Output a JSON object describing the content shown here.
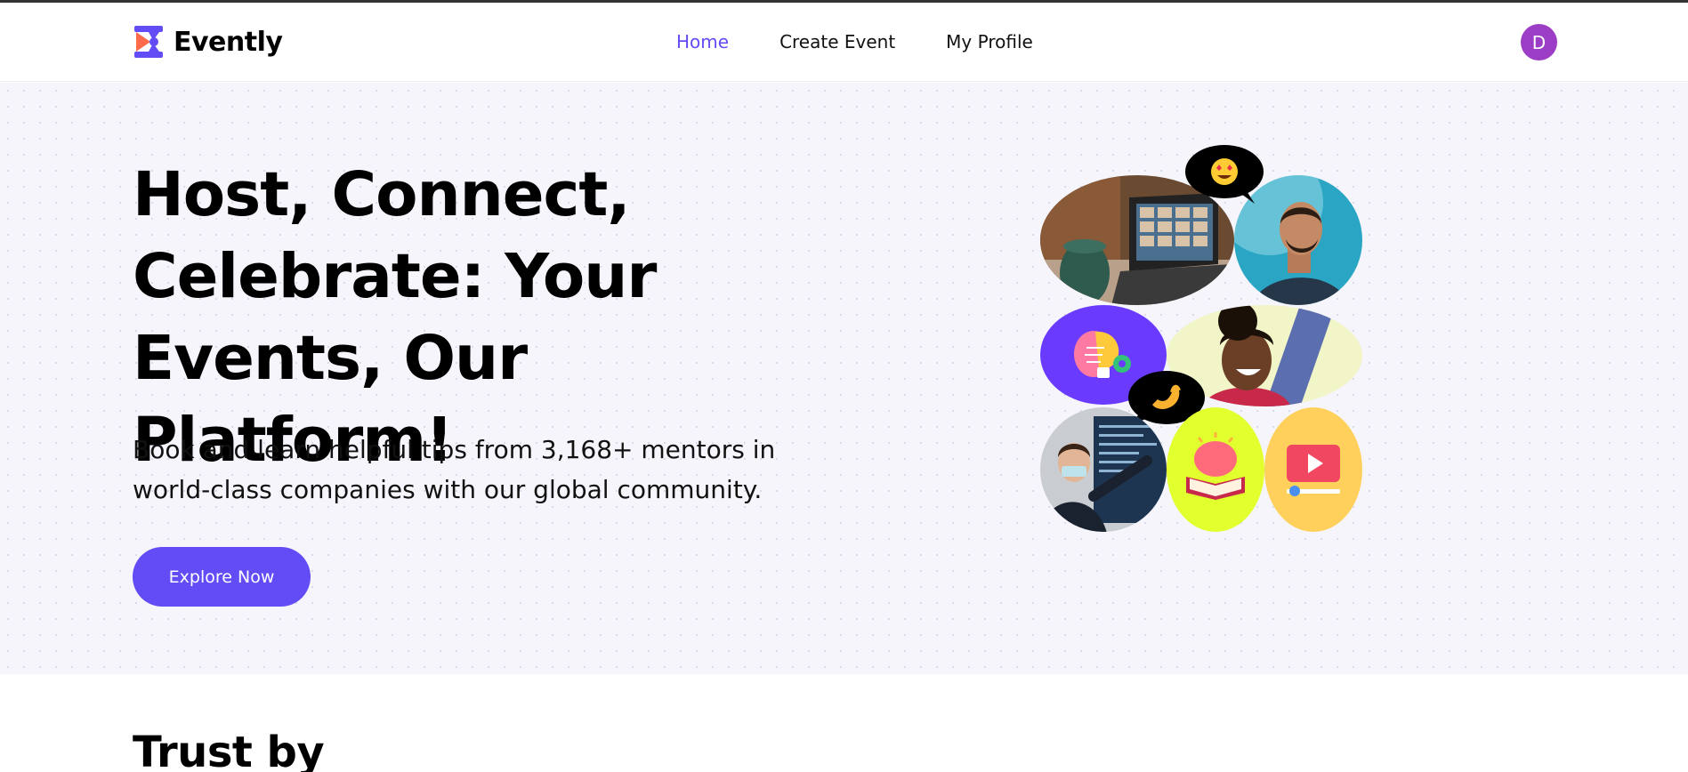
{
  "brand": {
    "name": "Evently"
  },
  "nav": {
    "items": [
      {
        "label": "Home",
        "active": true
      },
      {
        "label": "Create Event",
        "active": false
      },
      {
        "label": "My Profile",
        "active": false
      }
    ]
  },
  "user": {
    "avatar_initial": "D",
    "avatar_color": "#9c3dc6"
  },
  "hero": {
    "title_lines": [
      "Host, Connect,",
      "Celebrate: Your",
      "Events, Our Platform!"
    ],
    "subtitle_lines": [
      "Book and learn helpful tips from 3,168+ mentors in",
      "world-class companies with our global community."
    ],
    "cta_label": "Explore Now"
  },
  "trust": {
    "title": "Trust by"
  },
  "colors": {
    "accent": "#624cf5",
    "hero_bg": "#f5f5fb",
    "logo_orange": "#ff6b4a",
    "logo_purple": "#624cf5"
  },
  "collage_icons": [
    "laptop-video-call-photo",
    "smiling-man-photo",
    "heart-eyes-emoji",
    "brain-lightbulb-icon",
    "smiling-woman-photo",
    "waving-hand-emoji",
    "presenter-photo",
    "brain-book-icon",
    "video-play-icon"
  ]
}
